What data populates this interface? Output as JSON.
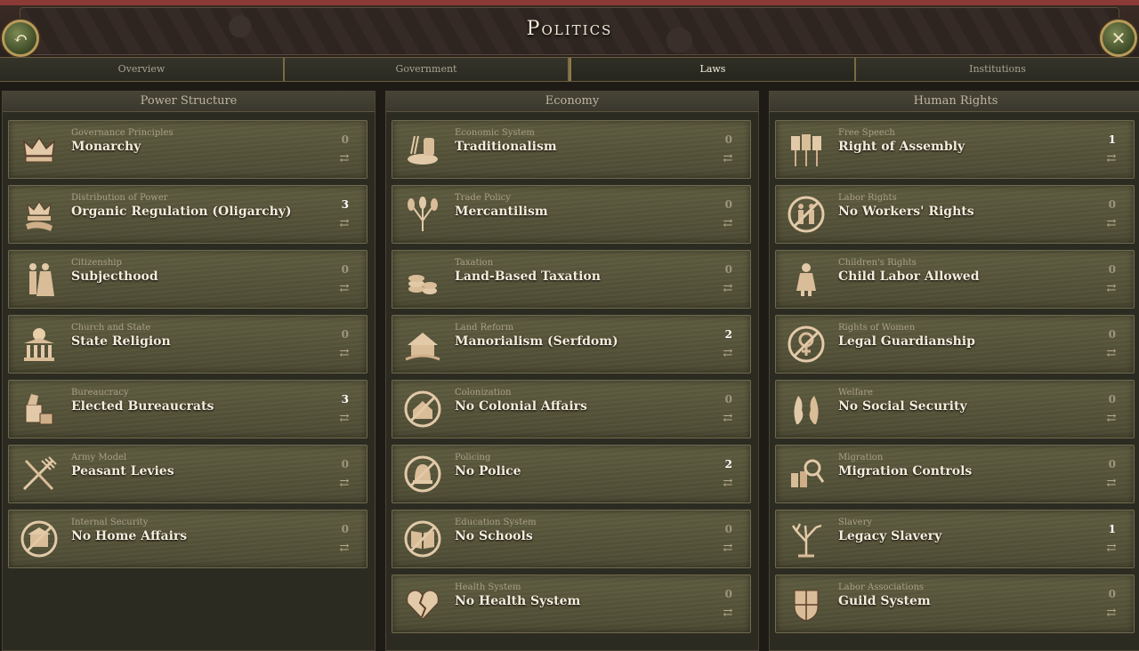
{
  "header": {
    "title": "Politics"
  },
  "tabs": [
    {
      "label": "Overview"
    },
    {
      "label": "Government"
    },
    {
      "label": "Laws"
    },
    {
      "label": "Institutions"
    }
  ],
  "columns": [
    {
      "title": "Power Structure",
      "laws": [
        {
          "category": "Governance Principles",
          "name": "Monarchy",
          "count": "0",
          "icon": "crown-icon"
        },
        {
          "category": "Distribution of Power",
          "name": "Organic Regulation (Oligarchy)",
          "count": "3",
          "icon": "crown-scroll-icon"
        },
        {
          "category": "Citizenship",
          "name": "Subjecthood",
          "count": "0",
          "icon": "couple-icon"
        },
        {
          "category": "Church and State",
          "name": "State Religion",
          "count": "0",
          "icon": "temple-sun-icon"
        },
        {
          "category": "Bureaucracy",
          "name": "Elected Bureaucrats",
          "count": "3",
          "icon": "inkwell-icon"
        },
        {
          "category": "Army Model",
          "name": "Peasant Levies",
          "count": "0",
          "icon": "pitchfork-icon"
        },
        {
          "category": "Internal Security",
          "name": "No Home Affairs",
          "count": "0",
          "icon": "no-building-icon"
        }
      ]
    },
    {
      "title": "Economy",
      "laws": [
        {
          "category": "Economic System",
          "name": "Traditionalism",
          "count": "0",
          "icon": "bread-icon"
        },
        {
          "category": "Trade Policy",
          "name": "Mercantilism",
          "count": "0",
          "icon": "wheat-icon"
        },
        {
          "category": "Taxation",
          "name": "Land-Based Taxation",
          "count": "0",
          "icon": "coins-icon"
        },
        {
          "category": "Land Reform",
          "name": "Manorialism (Serfdom)",
          "count": "2",
          "icon": "manor-icon"
        },
        {
          "category": "Colonization",
          "name": "No Colonial Affairs",
          "count": "0",
          "icon": "no-house-icon"
        },
        {
          "category": "Policing",
          "name": "No Police",
          "count": "2",
          "icon": "no-police-icon"
        },
        {
          "category": "Education System",
          "name": "No Schools",
          "count": "0",
          "icon": "no-book-icon"
        },
        {
          "category": "Health System",
          "name": "No Health System",
          "count": "0",
          "icon": "broken-heart-icon"
        }
      ]
    },
    {
      "title": "Human Rights",
      "laws": [
        {
          "category": "Free Speech",
          "name": "Right of Assembly",
          "count": "1",
          "icon": "banners-icon"
        },
        {
          "category": "Labor Rights",
          "name": "No Workers' Rights",
          "count": "0",
          "icon": "no-workers-icon"
        },
        {
          "category": "Children's Rights",
          "name": "Child Labor Allowed",
          "count": "0",
          "icon": "child-icon"
        },
        {
          "category": "Rights of Women",
          "name": "Legal Guardianship",
          "count": "0",
          "icon": "no-female-icon"
        },
        {
          "category": "Welfare",
          "name": "No Social Security",
          "count": "0",
          "icon": "hands-icon"
        },
        {
          "category": "Migration",
          "name": "Migration Controls",
          "count": "0",
          "icon": "magnifier-people-icon"
        },
        {
          "category": "Slavery",
          "name": "Legacy Slavery",
          "count": "1",
          "icon": "dead-tree-icon"
        },
        {
          "category": "Labor Associations",
          "name": "Guild System",
          "count": "0",
          "icon": "guild-crest-icon"
        }
      ]
    }
  ]
}
